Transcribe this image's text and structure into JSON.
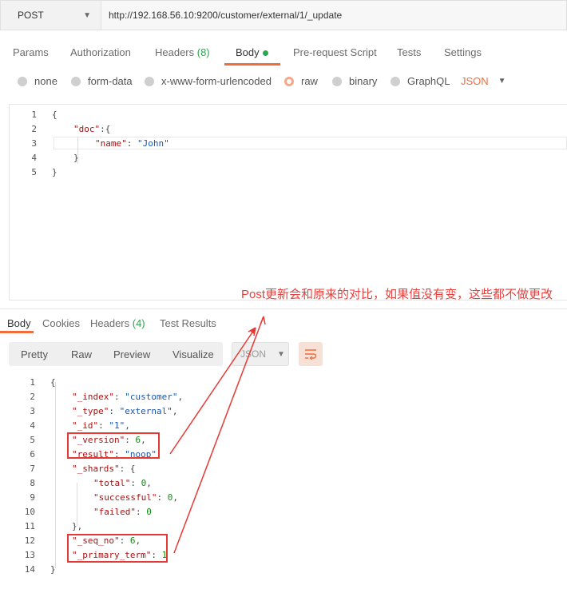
{
  "request": {
    "method": "POST",
    "url": "http://192.168.56.10:9200/customer/external/1/_update"
  },
  "req_tabs": [
    "Params",
    "Authorization",
    "Headers ",
    "(8)",
    "Body",
    "Pre-request Script",
    "Tests",
    "Settings"
  ],
  "body_types": [
    "none",
    "form-data",
    "x-www-form-urlencoded",
    "raw",
    "binary",
    "GraphQL"
  ],
  "body_lang": "JSON",
  "request_code": {
    "line_numbers": [
      "1",
      "2",
      "3",
      "4",
      "5"
    ],
    "brace_open": "{",
    "doc_key": "\"doc\"",
    "doc_open": ":{",
    "name_key": "\"name\"",
    "name_sep": ": ",
    "name_val": "\"John\"",
    "inner_close": "}",
    "brace_close": "}"
  },
  "res_tabs": {
    "body": "Body",
    "cookies": "Cookies",
    "headers": "Headers ",
    "headers_count": "(4)",
    "test_results": "Test Results"
  },
  "res_modes": [
    "Pretty",
    "Raw",
    "Preview",
    "Visualize"
  ],
  "res_lang": "JSON",
  "annotation": "Post更新会和原来的对比，如果值没有变，这些都不做更改",
  "response_code": {
    "line_numbers": [
      "1",
      "2",
      "3",
      "4",
      "5",
      "6",
      "7",
      "8",
      "9",
      "10",
      "11",
      "12",
      "13",
      "14"
    ],
    "l1": "{",
    "index_k": "\"_index\"",
    "index_v": "\"customer\"",
    "type_k": "\"_type\"",
    "type_v": "\"external\"",
    "id_k": "\"_id\"",
    "id_v": "\"1\"",
    "version_k": "\"_version\"",
    "version_v": "6",
    "result_k": "\"result\"",
    "result_v": "\"noop\"",
    "shards_k": "\"_shards\"",
    "shards_open": ": {",
    "total_k": "\"total\"",
    "total_v": "0",
    "successful_k": "\"successful\"",
    "successful_v": "0",
    "failed_k": "\"failed\"",
    "failed_v": "0",
    "shards_close": "},",
    "seq_k": "\"_seq_no\"",
    "seq_v": "6",
    "term_k": "\"_primary_term\"",
    "term_v": "1",
    "l14": "}",
    "colon": ": ",
    "comma": ","
  }
}
